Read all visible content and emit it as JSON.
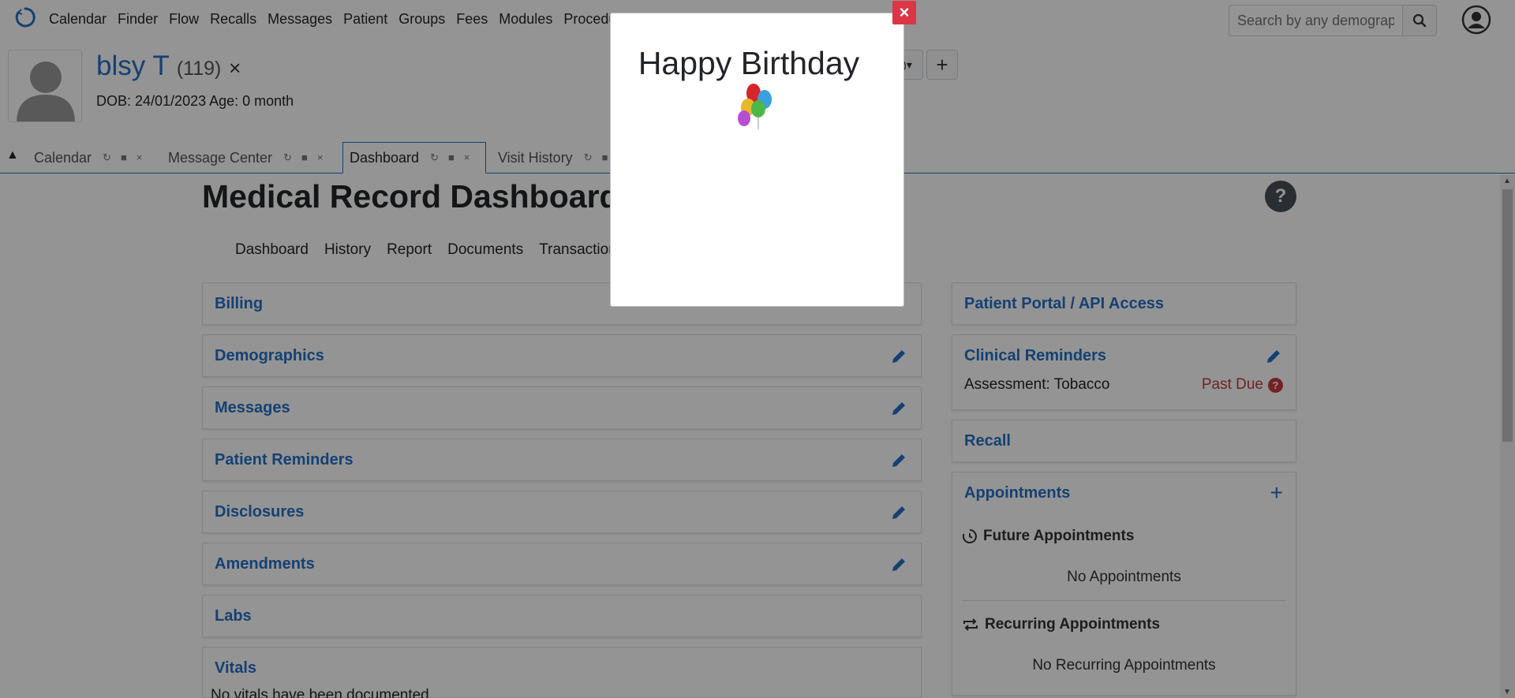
{
  "topnav": {
    "menu": [
      "Calendar",
      "Finder",
      "Flow",
      "Recalls",
      "Messages",
      "Patient",
      "Groups",
      "Fees",
      "Modules",
      "Procedures"
    ],
    "search_placeholder": "Search by any demographics"
  },
  "patient": {
    "name": "blsy T",
    "id": "(119)",
    "close": "×",
    "dob": "DOB: 24/01/2023 Age: 0 month"
  },
  "header_controls": {
    "dropdown": ")",
    "plus": "+"
  },
  "tabs": [
    {
      "label": "Calendar"
    },
    {
      "label": "Message Center"
    },
    {
      "label": "Dashboard"
    },
    {
      "label": "Visit History"
    }
  ],
  "dashboard": {
    "title": "Medical Record Dashboard -",
    "help": "?",
    "subnav": [
      "Dashboard",
      "History",
      "Report",
      "Documents",
      "Transactions"
    ]
  },
  "left_cards": [
    {
      "title": "Billing"
    },
    {
      "title": "Demographics"
    },
    {
      "title": "Messages"
    },
    {
      "title": "Patient Reminders"
    },
    {
      "title": "Disclosures"
    },
    {
      "title": "Amendments"
    },
    {
      "title": "Labs"
    },
    {
      "title": "Vitals",
      "text": "No vitals have been documented."
    }
  ],
  "right_cards": {
    "portal": "Patient Portal / API Access",
    "clinical_reminders": {
      "title": "Clinical Reminders",
      "item": "Assessment: Tobacco",
      "status": "Past Due",
      "status_icon": "?"
    },
    "recall": "Recall",
    "appointments": {
      "title": "Appointments",
      "add": "+",
      "future_heading": "Future Appointments",
      "future_empty": "No Appointments",
      "recurring_heading": "Recurring Appointments",
      "recurring_empty": "No Recurring Appointments"
    }
  },
  "modal": {
    "title": "Happy Birthday",
    "close": "×"
  },
  "colors": {
    "link_blue": "#2470c7",
    "danger": "#dc3545",
    "past_due": "#c63c3c"
  }
}
